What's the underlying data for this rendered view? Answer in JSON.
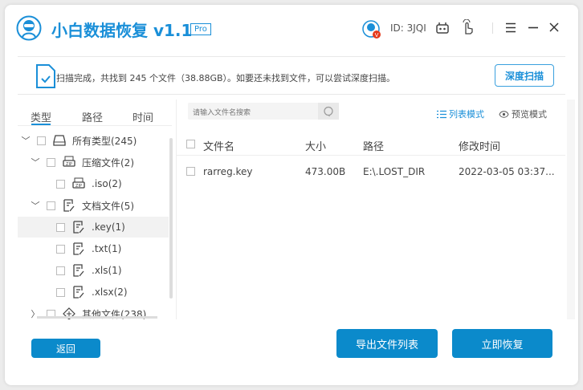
{
  "app": {
    "title": "小白数据恢复",
    "version": "v1.1",
    "edition": "Pro",
    "user_id": "ID: 3JQI",
    "accent": "#1a8fd8",
    "button_color": "#0b8acb"
  },
  "window_controls": [
    "menu-icon",
    "minimize-icon",
    "close-icon"
  ],
  "info_bar": {
    "message": "扫描完成，共找到 245 个文件（38.88GB）。如要还未找到文件，可以尝试深度扫描。",
    "deep_scan_label": "深度扫描"
  },
  "left_tabs": [
    {
      "label": "类型",
      "active": true
    },
    {
      "label": "路径"
    },
    {
      "label": "时间"
    }
  ],
  "tree": [
    {
      "label": "所有类型(245)",
      "level": 0,
      "expanded": true,
      "icon": "drive-icon"
    },
    {
      "label": "压缩文件(2)",
      "level": 1,
      "expanded": true,
      "icon": "zip-icon"
    },
    {
      "label": ".iso(2)",
      "level": 2,
      "icon": "zip-icon"
    },
    {
      "label": "文档文件(5)",
      "level": 1,
      "expanded": true,
      "icon": "document-icon"
    },
    {
      "label": ".key(1)",
      "level": 2,
      "icon": "document-icon",
      "selected": true
    },
    {
      "label": ".txt(1)",
      "level": 2,
      "icon": "document-icon"
    },
    {
      "label": ".xls(1)",
      "level": 2,
      "icon": "document-icon"
    },
    {
      "label": ".xlsx(2)",
      "level": 2,
      "icon": "document-icon"
    },
    {
      "label": "其他文件(238)",
      "level": 1,
      "expanded": false,
      "icon": "other-file-icon"
    }
  ],
  "search": {
    "placeholder": "请输入文件名搜索",
    "value": ""
  },
  "view_modes": {
    "list": "列表模式",
    "preview": "预览模式",
    "active": "list"
  },
  "table": {
    "columns": [
      "文件名",
      "大小",
      "路径",
      "修改时间"
    ],
    "rows": [
      {
        "name": "rarreg.key",
        "size": "473.00B",
        "path": "E:\\.LOST_DIR",
        "modified": "2022-03-05 03:37..."
      }
    ]
  },
  "buttons": {
    "back": "返回",
    "export": "导出文件列表",
    "recover": "立即恢复"
  }
}
